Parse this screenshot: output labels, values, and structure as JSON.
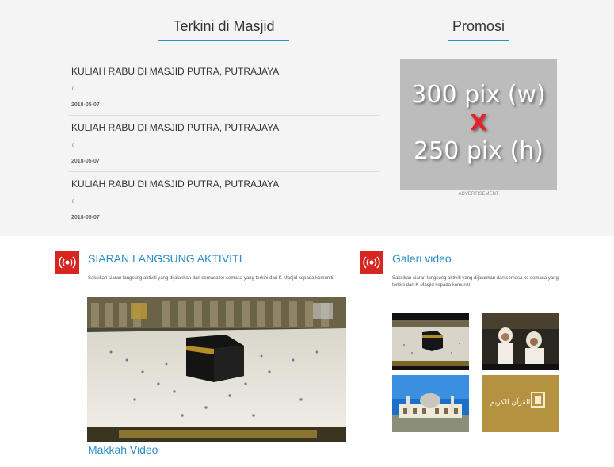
{
  "news": {
    "title": "Terkini di Masjid",
    "items": [
      {
        "title": "KULIAH RABU DI MASJID PUTRA, PUTRAJAYA",
        "count": "0",
        "date": "2018-05-07"
      },
      {
        "title": "KULIAH RABU DI MASJID PUTRA, PUTRAJAYA",
        "count": "0",
        "date": "2018-05-07"
      },
      {
        "title": "KULIAH RABU DI MASJID PUTRA, PUTRAJAYA",
        "count": "0",
        "date": "2018-05-07"
      }
    ]
  },
  "promo": {
    "title": "Promosi",
    "line1": "300 pix (w)",
    "line2": "X",
    "line3": "250 pix (h)",
    "ad_label": "ADVERTISEMENT"
  },
  "live": {
    "title": "SIARAN LANGSUNG AKTIVITI",
    "description": "Saksikan siaran langsung aktiviti yang dijalankan dari semasa ke semasa yang terkini dari K-Masjid kepada komuniti",
    "video_caption": "Makkah Video",
    "icon": "live-broadcast-icon"
  },
  "gallery": {
    "title": "Galeri video",
    "description": "Saksikan siaran langsung aktiviti yang dijalankan dari semasa ke semasa yang terkini dari K-Masjid kepada komuniti",
    "icon": "live-broadcast-icon",
    "logo_text": "القرآن الكريم"
  },
  "colors": {
    "accent": "#2a8fc4",
    "live_red": "#d7261f",
    "promo_bg": "#bcbcbc"
  }
}
